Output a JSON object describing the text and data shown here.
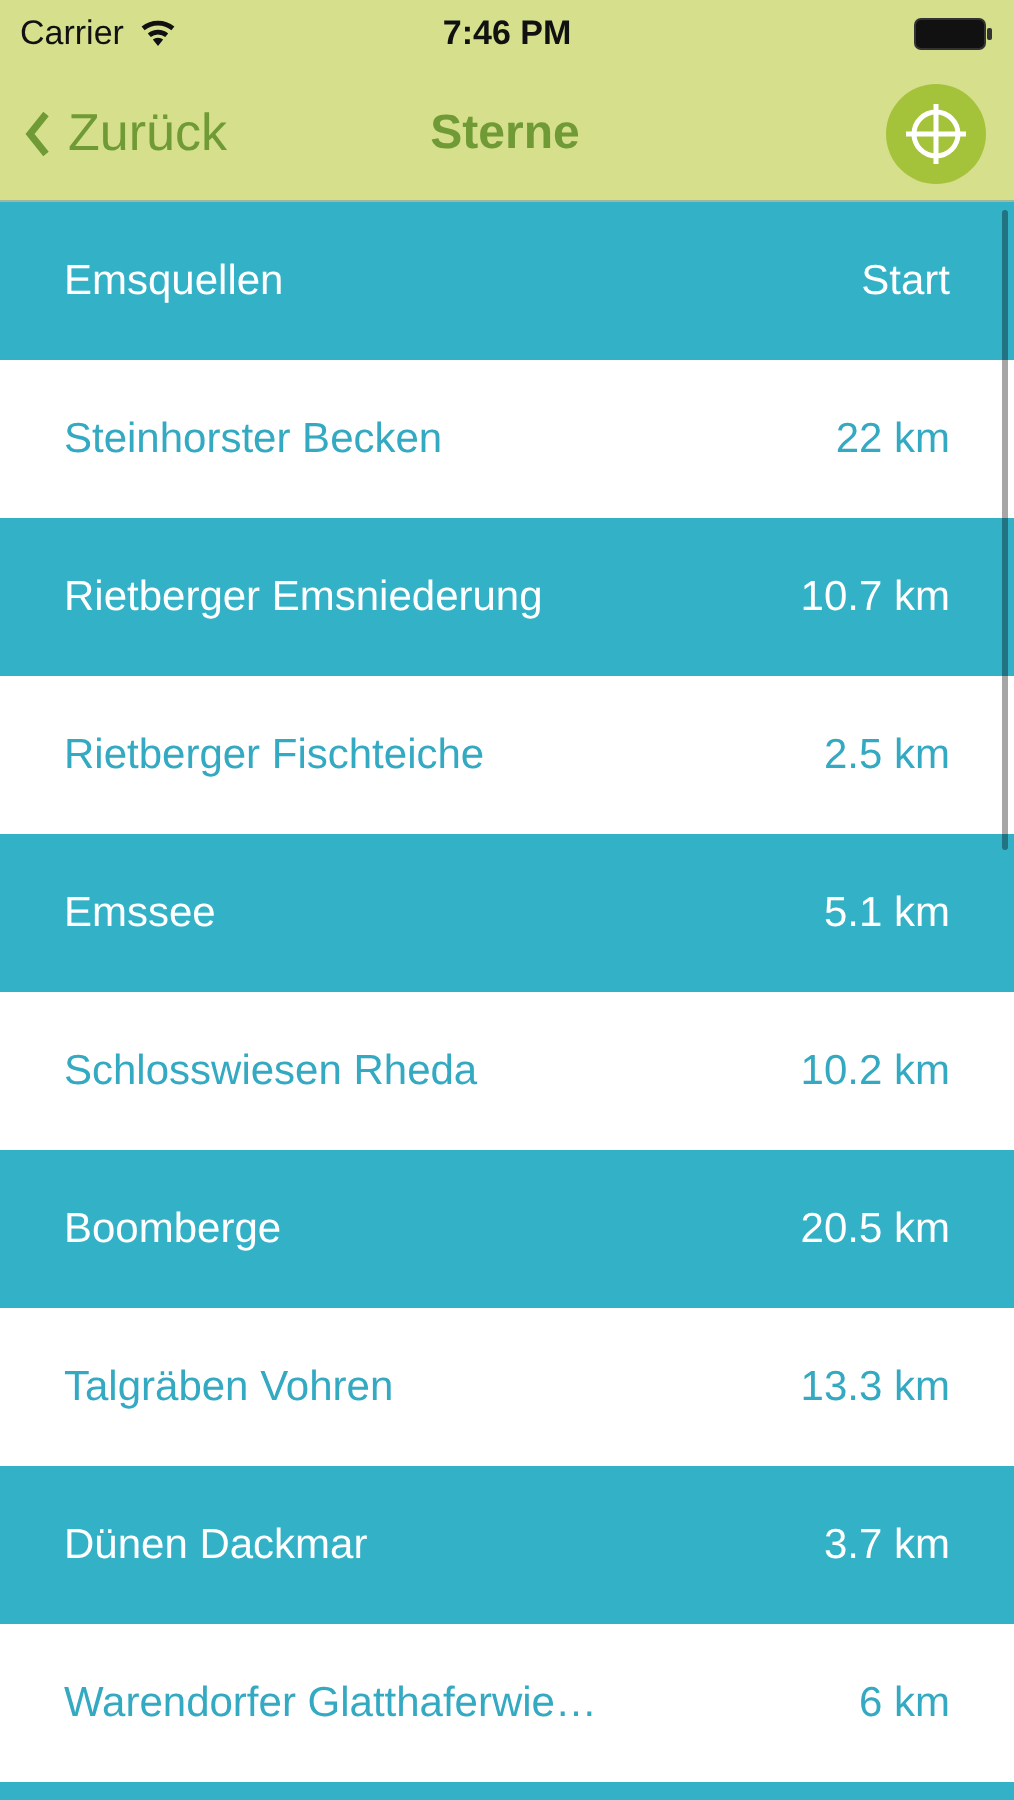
{
  "status_bar": {
    "carrier": "Carrier",
    "time": "7:46 PM"
  },
  "nav_bar": {
    "back": "Zurück",
    "title": "Sterne"
  },
  "rows": [
    {
      "name": "Emsquellen",
      "distance": "Start"
    },
    {
      "name": "Steinhorster Becken",
      "distance": "22 km"
    },
    {
      "name": "Rietberger Emsniederung",
      "distance": "10.7 km"
    },
    {
      "name": "Rietberger Fischteiche",
      "distance": "2.5 km"
    },
    {
      "name": "Emssee",
      "distance": "5.1 km"
    },
    {
      "name": "Schlosswiesen Rheda",
      "distance": "10.2 km"
    },
    {
      "name": "Boomberge",
      "distance": "20.5 km"
    },
    {
      "name": "Talgräben Vohren",
      "distance": "13.3 km"
    },
    {
      "name": "Dünen Dackmar",
      "distance": "3.7 km"
    },
    {
      "name": "Warendorfer Glatthaferwie…",
      "distance": "6 km"
    }
  ]
}
